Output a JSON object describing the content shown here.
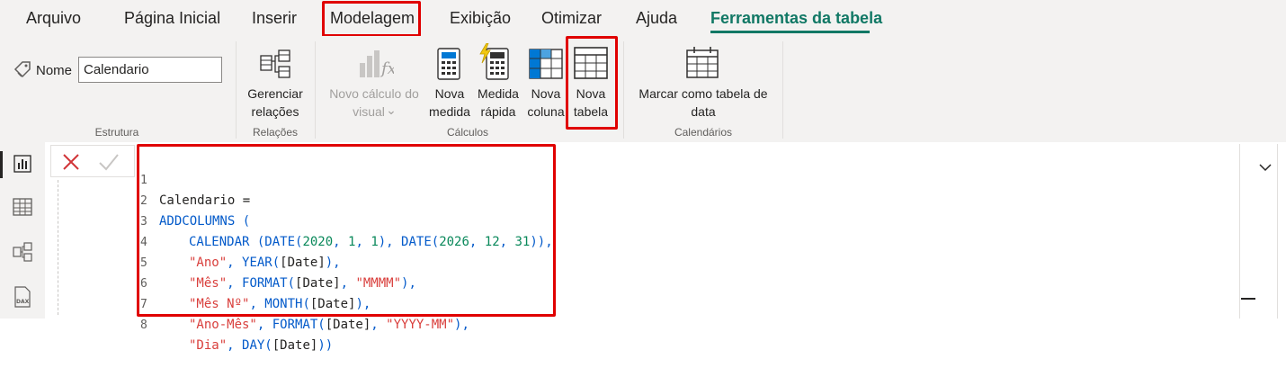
{
  "tabs": [
    {
      "label": "Arquivo"
    },
    {
      "label": "Página Inicial"
    },
    {
      "label": "Inserir"
    },
    {
      "label": "Modelagem"
    },
    {
      "label": "Exibição"
    },
    {
      "label": "Otimizar"
    },
    {
      "label": "Ajuda"
    },
    {
      "label": "Ferramentas da tabela"
    }
  ],
  "active_tab": "Ferramentas da tabela",
  "ribbon": {
    "estrutura": {
      "name_label": "Nome",
      "name_value": "Calendario",
      "group_label": "Estrutura"
    },
    "relacoes": {
      "button_line1": "Gerenciar",
      "button_line2": "relações",
      "group_label": "Relações"
    },
    "calculos": {
      "visual_line1": "Novo cálculo do",
      "visual_line2": "visual",
      "visual_dropdown": "⌄",
      "medida_line1": "Nova",
      "medida_line2": "medida",
      "rapida_line1": "Medida",
      "rapida_line2": "rápida",
      "coluna_line1": "Nova",
      "coluna_line2": "coluna",
      "tabela_line1": "Nova",
      "tabela_line2": "tabela",
      "group_label": "Cálculos"
    },
    "calendarios": {
      "button_line1": "Marcar como tabela de",
      "button_line2": "data",
      "group_label": "Calendários"
    }
  },
  "formula_bar": {
    "line_numbers": [
      "1",
      "2",
      "3",
      "4",
      "5",
      "6",
      "7",
      "8"
    ],
    "lines": {
      "l1": "Calendario =",
      "l2": "ADDCOLUMNS (",
      "l3a": "CALENDAR (DATE(",
      "l3b": "2020",
      "l3c": ", ",
      "l3d": "1",
      "l3e": ", ",
      "l3f": "1",
      "l3g": "), DATE(",
      "l3h": "2026",
      "l3i": ", ",
      "l3j": "12",
      "l3k": ", ",
      "l3l": "31",
      "l3m": ")),",
      "l4a": "\"Ano\"",
      "l4b": ", YEAR(",
      "l4c": "[Date]",
      "l4d": "),",
      "l5a": "\"Mês\"",
      "l5b": ", FORMAT(",
      "l5c": "[Date]",
      "l5d": ", ",
      "l5e": "\"MMMM\"",
      "l5f": "),",
      "l6a": "\"Mês Nº\"",
      "l6b": ", MONTH(",
      "l6c": "[Date]",
      "l6d": "),",
      "l7a": "\"Ano-Mês\"",
      "l7b": ", FORMAT(",
      "l7c": "[Date]",
      "l7d": ", ",
      "l7e": "\"YYYY-MM\"",
      "l7f": "),",
      "l8a": "\"Dia\"",
      "l8b": ", DAY(",
      "l8c": "[Date]",
      "l8d": "))"
    }
  },
  "colors": {
    "accent": "#117865",
    "highlight": "#e00000",
    "keyword": "#035aca",
    "string": "#d93f3c",
    "number": "#09885a"
  },
  "icons": {
    "rail": [
      "report-view-icon",
      "table-view-icon",
      "model-view-icon",
      "dax-query-view-icon"
    ]
  }
}
